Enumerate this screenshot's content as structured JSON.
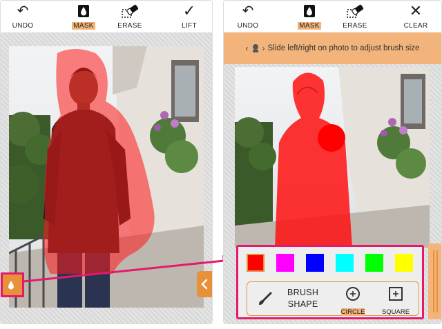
{
  "left_screen": {
    "toolbar": [
      {
        "label": "UNDO",
        "icon": "undo-icon",
        "active": false
      },
      {
        "label": "MASK",
        "icon": "mask-drop-icon",
        "active": true
      },
      {
        "label": "ERASE",
        "icon": "eraser-icon",
        "active": false
      },
      {
        "label": "LIFT",
        "icon": "check-icon",
        "active": false
      }
    ]
  },
  "right_screen": {
    "toolbar": [
      {
        "label": "UNDO",
        "icon": "undo-icon",
        "active": false
      },
      {
        "label": "MASK",
        "icon": "mask-drop-icon",
        "active": true
      },
      {
        "label": "ERASE",
        "icon": "eraser-icon",
        "active": false
      },
      {
        "label": "CLEAR",
        "icon": "close-icon",
        "active": false
      }
    ],
    "hint": "Slide left/right on photo to adjust brush size",
    "colors": [
      "#ff0000",
      "#ff00ff",
      "#0000ff",
      "#00ffff",
      "#00ff00",
      "#ffff00"
    ],
    "selected_color": "#ff0000",
    "brush_shape_label_line1": "BRUSH",
    "brush_shape_label_line2": "SHAPE",
    "shapes": [
      {
        "label": "CIRCLE",
        "icon": "circle-brush-icon",
        "active": true
      },
      {
        "label": "SQUARE",
        "icon": "square-brush-icon",
        "active": false
      }
    ]
  },
  "colors": {
    "accent_orange": "#e8903a",
    "highlight_peach": "#f2b47a",
    "annotation_pink": "#e5196a",
    "mask_red": "#ff0000"
  }
}
